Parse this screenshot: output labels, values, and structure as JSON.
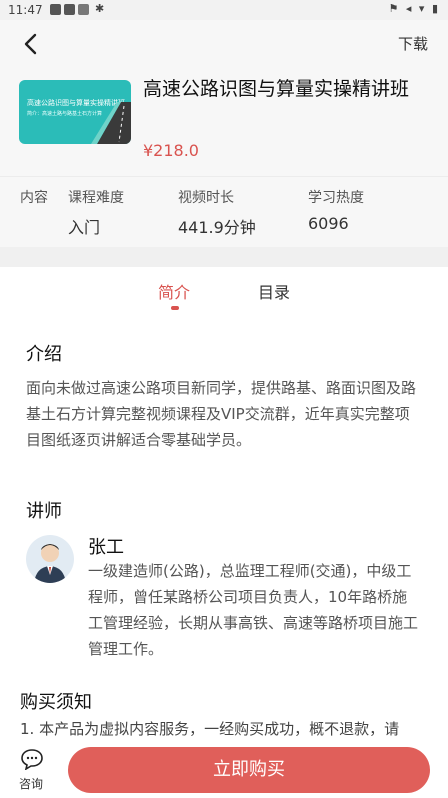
{
  "status_bar": {
    "time": "11:47",
    "glyphs": "⚑ ◂ ▾ ▮"
  },
  "header": {
    "download_label": "下载"
  },
  "course": {
    "thumbnail_title": "高速公路识图与算量实操精讲班",
    "thumbnail_sub": "简介：高速土路与路基土石方计算",
    "title": "高速公路识图与算量实操精讲班",
    "price": "¥218.0"
  },
  "stats": {
    "content_label": "内容",
    "difficulty_label": "课程难度",
    "difficulty_value": "入门",
    "duration_label": "视频时长",
    "duration_value": "441.9分钟",
    "popularity_label": "学习热度",
    "popularity_value": "6096"
  },
  "tabs": [
    {
      "label": "简介",
      "active": true
    },
    {
      "label": "目录",
      "active": false
    }
  ],
  "intro": {
    "title": "介绍",
    "text": "面向未做过高速公路项目新同学，提供路基、路面识图及路基土石方计算完整视频课程及VIP交流群，近年真实完整项目图纸逐页讲解适合零基础学员。"
  },
  "teacher": {
    "section_title": "讲师",
    "name": "张工",
    "desc": "一级建造师(公路)，总监理工程师(交通)，中级工程师，曾任某路桥公司项目负责人，10年路桥施工管理经验，长期从事高铁、高速等路桥项目施工管理工作。"
  },
  "purchase": {
    "title": "购买须知",
    "notice": "1. 本产品为虚拟内容服务，一经购买成功，概不退款，请"
  },
  "bottom": {
    "consult_label": "咨询",
    "buy_label": "立即购买"
  },
  "colors": {
    "accent": "#d9534f",
    "buy_button": "#e05f5a",
    "thumbnail": "#2bbcb8"
  }
}
